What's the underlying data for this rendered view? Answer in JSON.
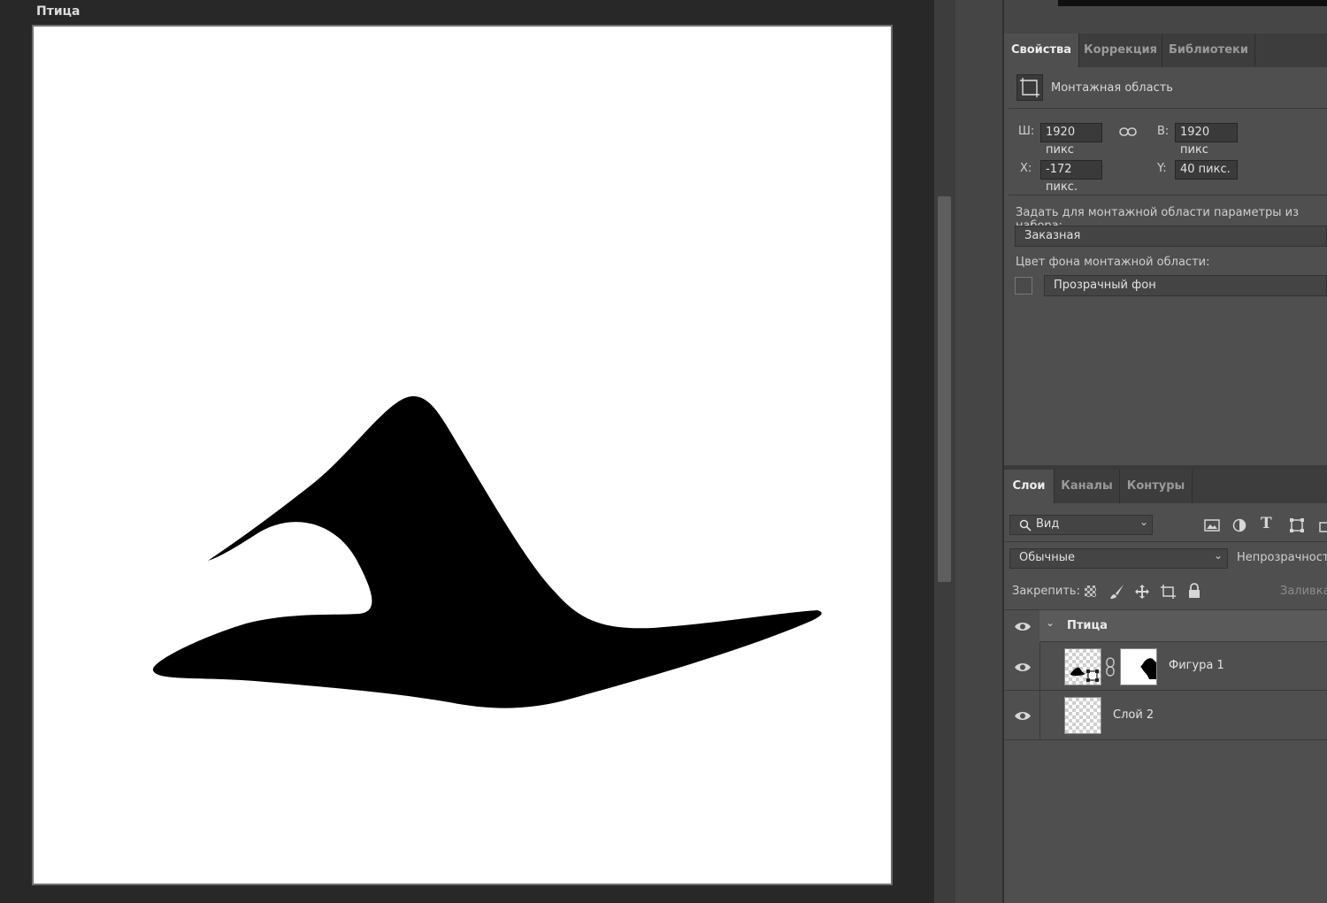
{
  "document": {
    "artboard_title": "Птица"
  },
  "properties_panel": {
    "tabs": [
      {
        "label": "Свойства",
        "active": true
      },
      {
        "label": "Коррекция",
        "active": false
      },
      {
        "label": "Библиотеки",
        "active": false
      }
    ],
    "section_title": "Монтажная область",
    "width_label": "Ш:",
    "width_value": "1920 пикс",
    "height_label": "В:",
    "height_value": "1920 пикс",
    "x_label": "X:",
    "x_value": "-172 пикс.",
    "y_label": "Y:",
    "y_value": "40 пикс.",
    "preset_label": "Задать для монтажной области параметры из набора:",
    "preset_value": "Заказная",
    "bg_label": "Цвет фона монтажной области:",
    "bg_value": "Прозрачный фон"
  },
  "layers_panel": {
    "tabs": [
      {
        "label": "Слои",
        "active": true
      },
      {
        "label": "Каналы",
        "active": false
      },
      {
        "label": "Контуры",
        "active": false
      }
    ],
    "filter_value": "Вид",
    "blend_mode": "Обычные",
    "opacity_label": "Непрозрачность",
    "lock_label": "Закрепить:",
    "fill_label": "Заливка",
    "layers": [
      {
        "name": "Птица",
        "type": "group"
      },
      {
        "name": "Фигура 1",
        "type": "shape"
      },
      {
        "name": "Слой 2",
        "type": "pixel"
      }
    ]
  },
  "colors": {
    "workspace_bg": "#282828",
    "panel_bg": "#4f4f4f",
    "tab_bar_bg": "#3d3d3d",
    "shape_fill": "#000000"
  }
}
